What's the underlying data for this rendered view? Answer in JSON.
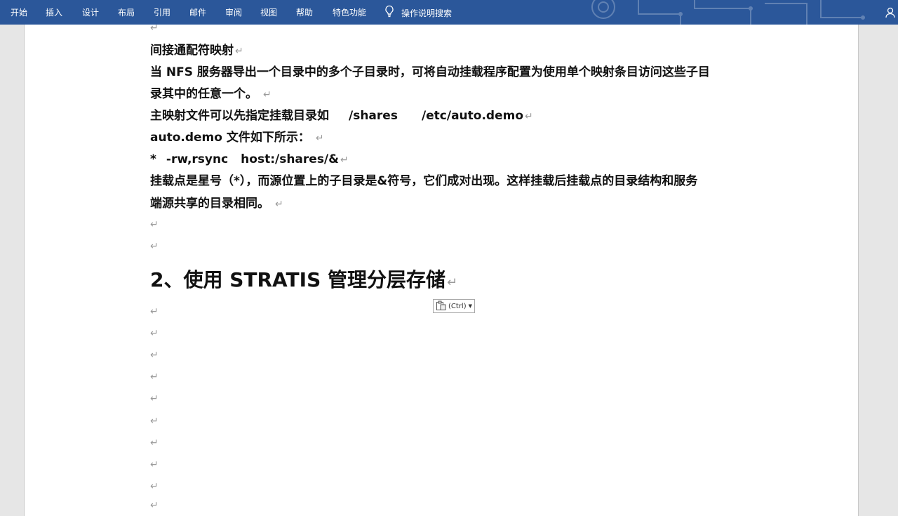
{
  "ribbon": {
    "tabs": [
      "开始",
      "插入",
      "设计",
      "布局",
      "引用",
      "邮件",
      "审阅",
      "视图",
      "帮助",
      "特色功能"
    ],
    "tell_me": "操作说明搜索"
  },
  "document": {
    "lines": [
      {
        "parts": [
          "间接通配符映射"
        ]
      },
      {
        "parts": [
          "当 NFS 服务器导出一个目录中的多个子目录时，可将自动挂载程序配置为使用单个映射条目访问这些子目"
        ]
      },
      {
        "parts": [
          "录其中的任意一个。"
        ]
      },
      {
        "parts": [
          "主映射文件可以先指定挂载目录如",
          "/shares",
          "/etc/auto.demo"
        ]
      },
      {
        "parts": [
          "auto.demo 文件如下所示："
        ]
      },
      {
        "parts": [
          "*",
          "-rw,rsync",
          "host:/shares/&"
        ]
      },
      {
        "parts": [
          "挂载点是星号（*），而源位置上的子目录是&符号，它们成对出现。这样挂载后挂载点的目录结构和服务"
        ]
      },
      {
        "parts": [
          "端源共享的目录相同。"
        ]
      }
    ],
    "heading": "2、使用 STRATIS 管理分层存储",
    "paragraph_mark": "↵",
    "paste_options_label": "(Ctrl)"
  },
  "icons": {
    "tell_me": "lightbulb-icon",
    "account": "person-icon",
    "paste": "clipboard-icon",
    "dropdown": "dropdown-caret-icon"
  },
  "colors": {
    "ribbon": "#2b579a",
    "page": "#ffffff",
    "canvas": "#e6e6e6",
    "paragraph_mark": "#9a9a9a"
  }
}
